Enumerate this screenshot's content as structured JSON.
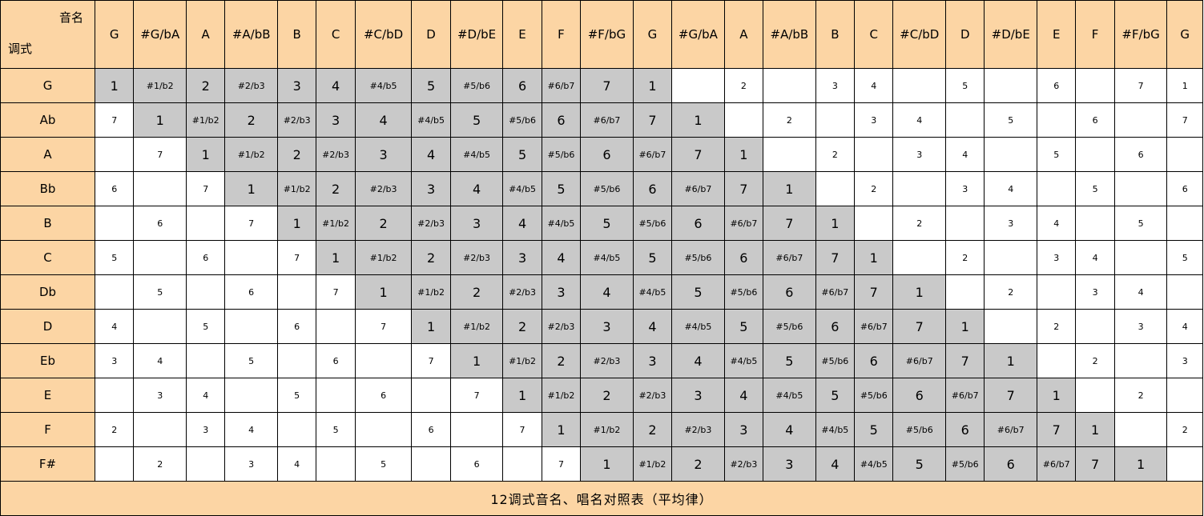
{
  "corner": {
    "top_label": "音名",
    "bottom_label": "调式"
  },
  "columns": [
    "G",
    "#G/bA",
    "A",
    "#A/bB",
    "B",
    "C",
    "#C/bD",
    "D",
    "#D/bE",
    "E",
    "F",
    "#F/bG",
    "G",
    "#G/bA",
    "A",
    "#A/bB",
    "B",
    "C",
    "#C/bD",
    "D",
    "#D/bE",
    "E",
    "F",
    "#F/bG",
    "G"
  ],
  "rows": [
    {
      "key": "G",
      "start": 0,
      "cells": [
        "1",
        "#1/b2",
        "2",
        "#2/b3",
        "3",
        "4",
        "#4/b5",
        "5",
        "#5/b6",
        "6",
        "#6/b7",
        "7",
        "1",
        "",
        "2",
        "",
        "3",
        "4",
        "",
        "5",
        "",
        "6",
        "",
        "7",
        "1"
      ]
    },
    {
      "key": "Ab",
      "start": 1,
      "cells": [
        "7",
        "1",
        "#1/b2",
        "2",
        "#2/b3",
        "3",
        "4",
        "#4/b5",
        "5",
        "#5/b6",
        "6",
        "#6/b7",
        "7",
        "1",
        "",
        "2",
        "",
        "3",
        "4",
        "",
        "5",
        "",
        "6",
        "",
        "7"
      ]
    },
    {
      "key": "A",
      "start": 2,
      "cells": [
        "",
        "7",
        "1",
        "#1/b2",
        "2",
        "#2/b3",
        "3",
        "4",
        "#4/b5",
        "5",
        "#5/b6",
        "6",
        "#6/b7",
        "7",
        "1",
        "",
        "2",
        "",
        "3",
        "4",
        "",
        "5",
        "",
        "6",
        ""
      ]
    },
    {
      "key": "Bb",
      "start": 3,
      "cells": [
        "6",
        "",
        "7",
        "1",
        "#1/b2",
        "2",
        "#2/b3",
        "3",
        "4",
        "#4/b5",
        "5",
        "#5/b6",
        "6",
        "#6/b7",
        "7",
        "1",
        "",
        "2",
        "",
        "3",
        "4",
        "",
        "5",
        "",
        "6"
      ]
    },
    {
      "key": "B",
      "start": 4,
      "cells": [
        "",
        "6",
        "",
        "7",
        "1",
        "#1/b2",
        "2",
        "#2/b3",
        "3",
        "4",
        "#4/b5",
        "5",
        "#5/b6",
        "6",
        "#6/b7",
        "7",
        "1",
        "",
        "2",
        "",
        "3",
        "4",
        "",
        "5",
        ""
      ]
    },
    {
      "key": "C",
      "start": 5,
      "cells": [
        "5",
        "",
        "6",
        "",
        "7",
        "1",
        "#1/b2",
        "2",
        "#2/b3",
        "3",
        "4",
        "#4/b5",
        "5",
        "#5/b6",
        "6",
        "#6/b7",
        "7",
        "1",
        "",
        "2",
        "",
        "3",
        "4",
        "",
        "5"
      ]
    },
    {
      "key": "Db",
      "start": 6,
      "cells": [
        "",
        "5",
        "",
        "6",
        "",
        "7",
        "1",
        "#1/b2",
        "2",
        "#2/b3",
        "3",
        "4",
        "#4/b5",
        "5",
        "#5/b6",
        "6",
        "#6/b7",
        "7",
        "1",
        "",
        "2",
        "",
        "3",
        "4",
        ""
      ]
    },
    {
      "key": "D",
      "start": 7,
      "cells": [
        "4",
        "",
        "5",
        "",
        "6",
        "",
        "7",
        "1",
        "#1/b2",
        "2",
        "#2/b3",
        "3",
        "4",
        "#4/b5",
        "5",
        "#5/b6",
        "6",
        "#6/b7",
        "7",
        "1",
        "",
        "2",
        "",
        "3",
        "4"
      ]
    },
    {
      "key": "Eb",
      "start": 8,
      "cells": [
        "3",
        "4",
        "",
        "5",
        "",
        "6",
        "",
        "7",
        "1",
        "#1/b2",
        "2",
        "#2/b3",
        "3",
        "4",
        "#4/b5",
        "5",
        "#5/b6",
        "6",
        "#6/b7",
        "7",
        "1",
        "",
        "2",
        "",
        "3"
      ]
    },
    {
      "key": "E",
      "start": 9,
      "cells": [
        "",
        "3",
        "4",
        "",
        "5",
        "",
        "6",
        "",
        "7",
        "1",
        "#1/b2",
        "2",
        "#2/b3",
        "3",
        "4",
        "#4/b5",
        "5",
        "#5/b6",
        "6",
        "#6/b7",
        "7",
        "1",
        "",
        "2",
        ""
      ]
    },
    {
      "key": "F",
      "start": 10,
      "cells": [
        "2",
        "",
        "3",
        "4",
        "",
        "5",
        "",
        "6",
        "",
        "7",
        "1",
        "#1/b2",
        "2",
        "#2/b3",
        "3",
        "4",
        "#4/b5",
        "5",
        "#5/b6",
        "6",
        "#6/b7",
        "7",
        "1",
        "",
        "2"
      ]
    },
    {
      "key": "F#",
      "start": 11,
      "cells": [
        "",
        "2",
        "",
        "3",
        "4",
        "",
        "5",
        "",
        "6",
        "",
        "7",
        "1",
        "#1/b2",
        "2",
        "#2/b3",
        "3",
        "4",
        "#4/b5",
        "5",
        "#5/b6",
        "6",
        "#6/b7",
        "7",
        "1",
        ""
      ]
    }
  ],
  "footer": "12调式音名、唱名对照表（平均律）",
  "colors": {
    "header_bg": "#fcd5a4",
    "highlight_bg": "#c9c9c9",
    "border": "#000000"
  }
}
